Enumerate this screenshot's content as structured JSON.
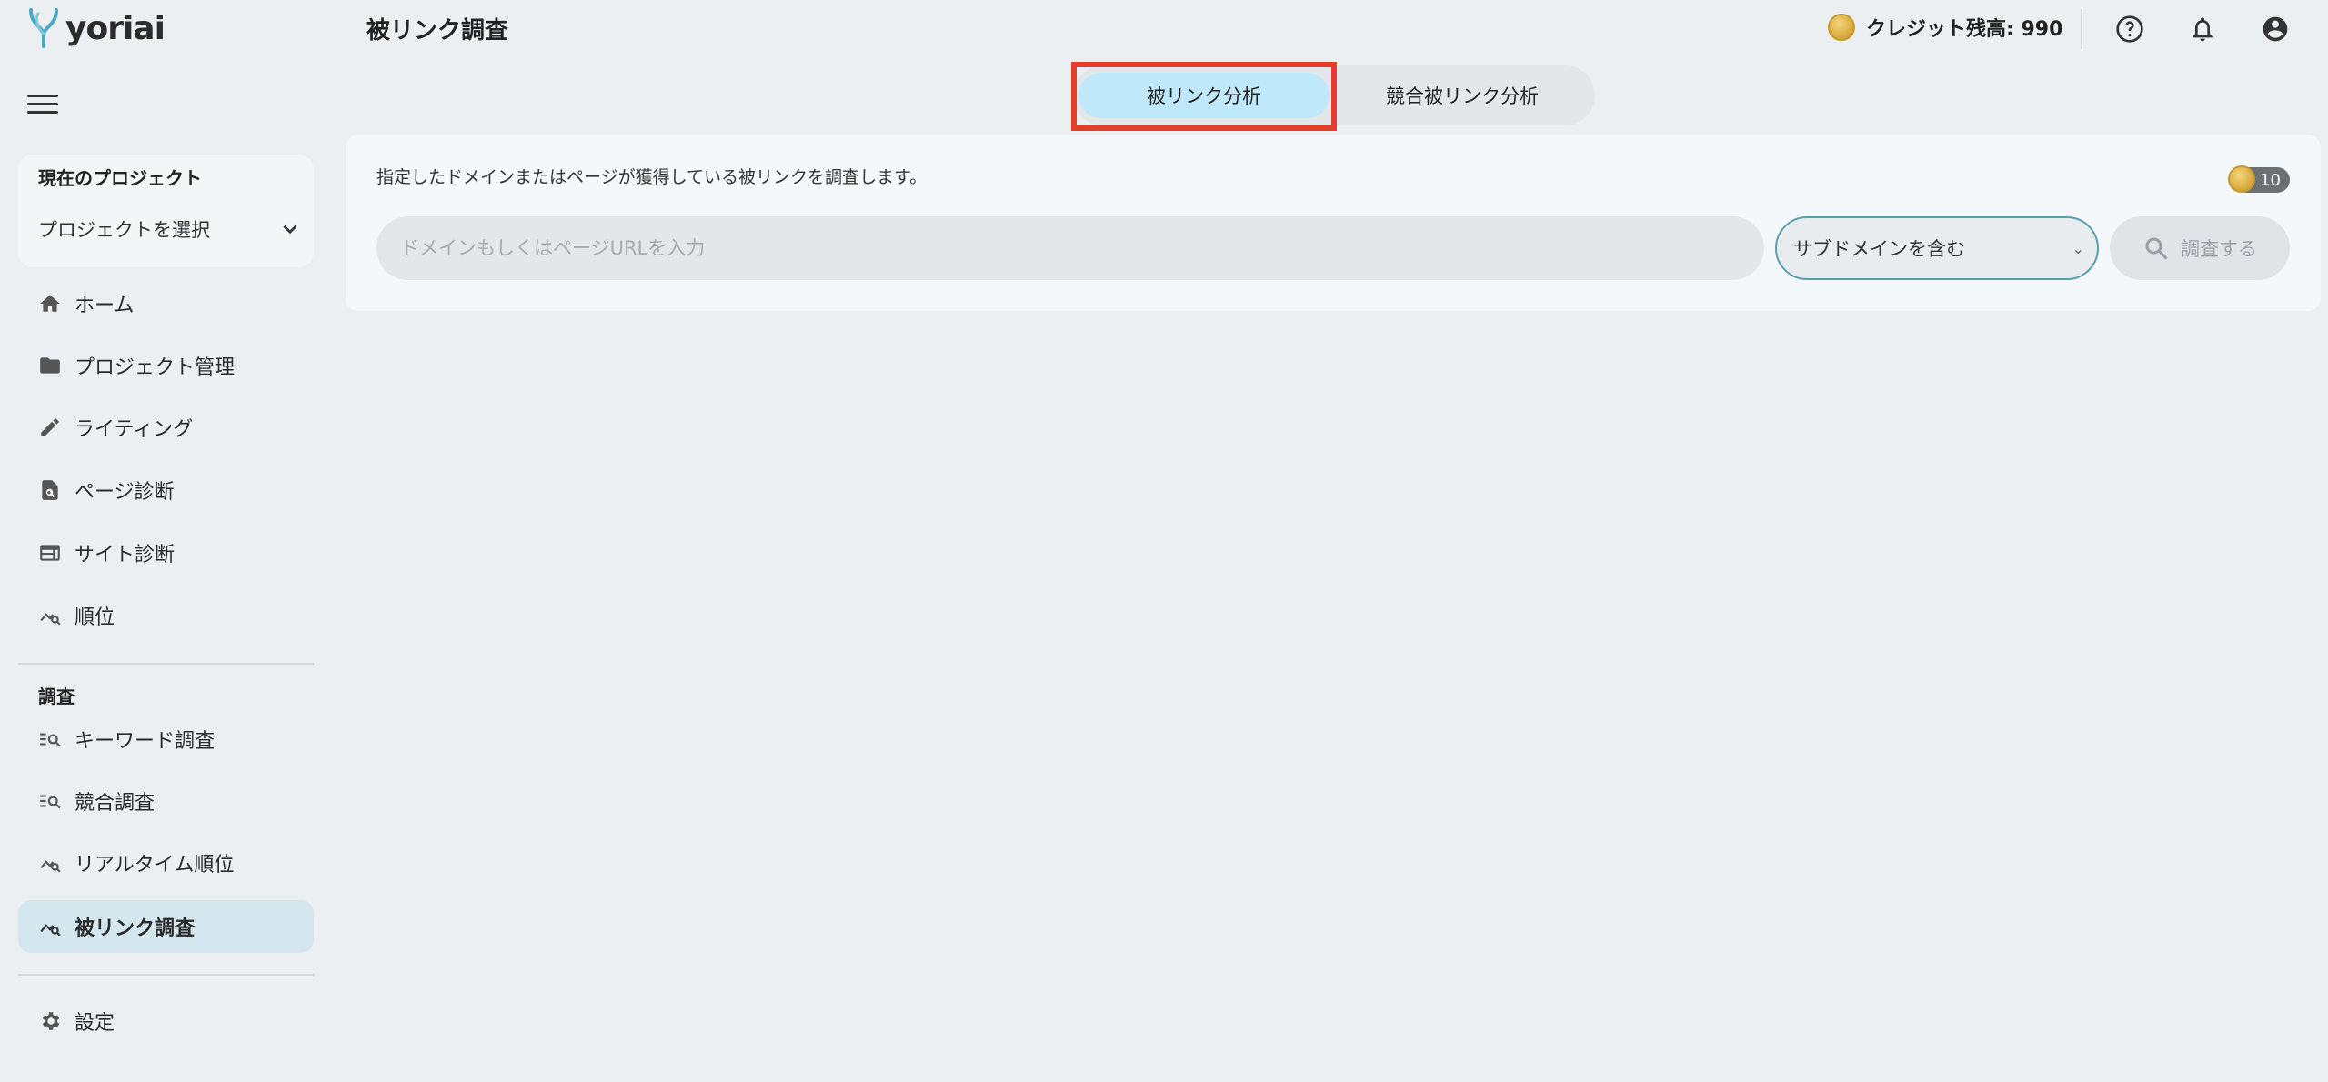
{
  "app": {
    "logo_text": "yoriai",
    "page_title": "被リンク調査"
  },
  "header": {
    "credit_label": "クレジット残高: 990",
    "icons": [
      "help-icon",
      "bell-icon",
      "account-icon"
    ]
  },
  "sidebar": {
    "project_title": "現在のプロジェクト",
    "project_select": "プロジェクトを選択",
    "items": [
      {
        "label": "ホーム",
        "icon": "home-icon"
      },
      {
        "label": "プロジェクト管理",
        "icon": "folder-icon"
      },
      {
        "label": "ライティング",
        "icon": "pencil-icon"
      },
      {
        "label": "ページ診断",
        "icon": "page-search-icon"
      },
      {
        "label": "サイト診断",
        "icon": "web-icon"
      },
      {
        "label": "順位",
        "icon": "ranking-icon"
      }
    ],
    "section_label": "調査",
    "research_items": [
      {
        "label": "キーワード調査",
        "icon": "list-search-icon"
      },
      {
        "label": "競合調査",
        "icon": "list-search-icon"
      },
      {
        "label": "リアルタイム順位",
        "icon": "ranking-icon"
      },
      {
        "label": "被リンク調査",
        "icon": "ranking-icon",
        "active": true
      }
    ],
    "settings_label": "設定"
  },
  "tabs": [
    {
      "label": "被リンク分析",
      "active": true
    },
    {
      "label": "競合被リンク分析",
      "active": false
    }
  ],
  "card": {
    "description": "指定したドメインまたはページが獲得している被リンクを調査します。",
    "cost": "10",
    "input_placeholder": "ドメインもしくはページURLを入力",
    "input_value": "",
    "select_value": "サブドメインを含む",
    "search_button": "調査する"
  },
  "colors": {
    "active_tab": "#bfe9fb",
    "active_nav": "#d4e6ee",
    "highlight": "#e23e2b",
    "select_border": "#5a9eb0"
  }
}
